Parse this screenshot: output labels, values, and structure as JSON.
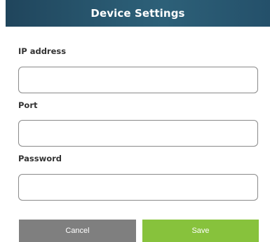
{
  "dialog": {
    "title": "Device Settings",
    "header_color": "#2a5b73"
  },
  "fields": {
    "ip": {
      "label": "IP address",
      "value": "",
      "placeholder": ""
    },
    "port": {
      "label": "Port",
      "value": "",
      "placeholder": ""
    },
    "password": {
      "label": "Password",
      "value": "",
      "placeholder": ""
    }
  },
  "buttons": {
    "cancel_label": "Cancel",
    "cancel_color": "#7f7f7f",
    "save_label": "Save",
    "save_color": "#87c23c"
  }
}
